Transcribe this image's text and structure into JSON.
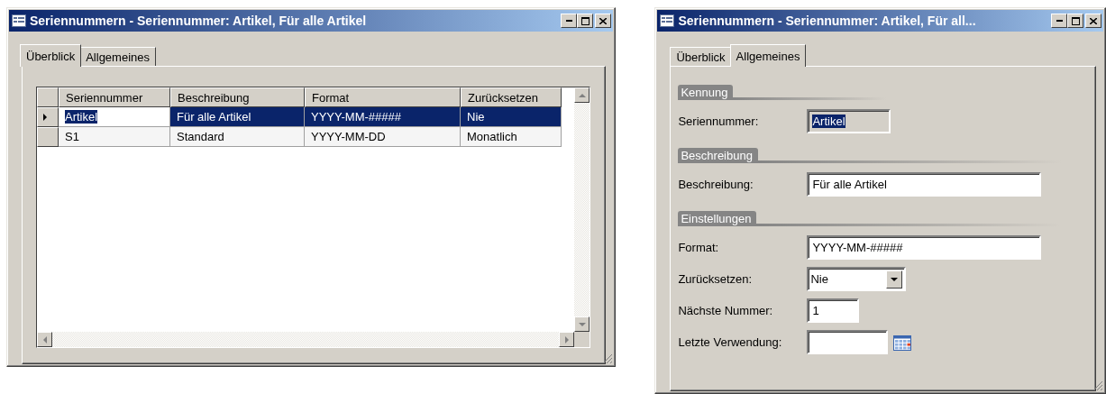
{
  "windows": [
    {
      "kind": "grid",
      "title": "Seriennummern - Seriennummer: Artikel, Für alle Artikel",
      "tabs": [
        {
          "label": "Überblick",
          "selected": true
        },
        {
          "label": "Allgemeines",
          "selected": false
        }
      ],
      "grid": {
        "columns": [
          "Seriennummer",
          "Beschreibung",
          "Format",
          "Zurücksetzen"
        ],
        "rows": [
          {
            "selected": true,
            "cells": [
              "Artikel",
              "Für alle Artikel",
              "YYYY-MM-#####",
              "Nie"
            ]
          },
          {
            "selected": false,
            "cells": [
              "S1",
              "Standard",
              "YYYY-MM-DD",
              "Monatlich"
            ]
          }
        ]
      }
    },
    {
      "kind": "form",
      "title": "Seriennummern - Seriennummer: Artikel, Für all...",
      "tabs": [
        {
          "label": "Überblick",
          "selected": false
        },
        {
          "label": "Allgemeines",
          "selected": true
        }
      ],
      "sections": [
        {
          "title": "Kennung",
          "fields": [
            {
              "kind": "readonly",
              "label": "Seriennummer:",
              "value": "Artikel",
              "focused": true
            }
          ]
        },
        {
          "title": "Beschreibung",
          "fields": [
            {
              "kind": "text",
              "label": "Beschreibung:",
              "value": "Für alle Artikel"
            }
          ]
        },
        {
          "title": "Einstellungen",
          "fields": [
            {
              "kind": "text",
              "label": "Format:",
              "value": "YYYY-MM-#####"
            },
            {
              "kind": "dropdown",
              "label": "Zurücksetzen:",
              "value": "Nie"
            },
            {
              "kind": "number",
              "label": "Nächste Nummer:",
              "value": "1"
            },
            {
              "kind": "date",
              "label": "Letzte Verwendung:"
            }
          ]
        }
      ]
    }
  ]
}
